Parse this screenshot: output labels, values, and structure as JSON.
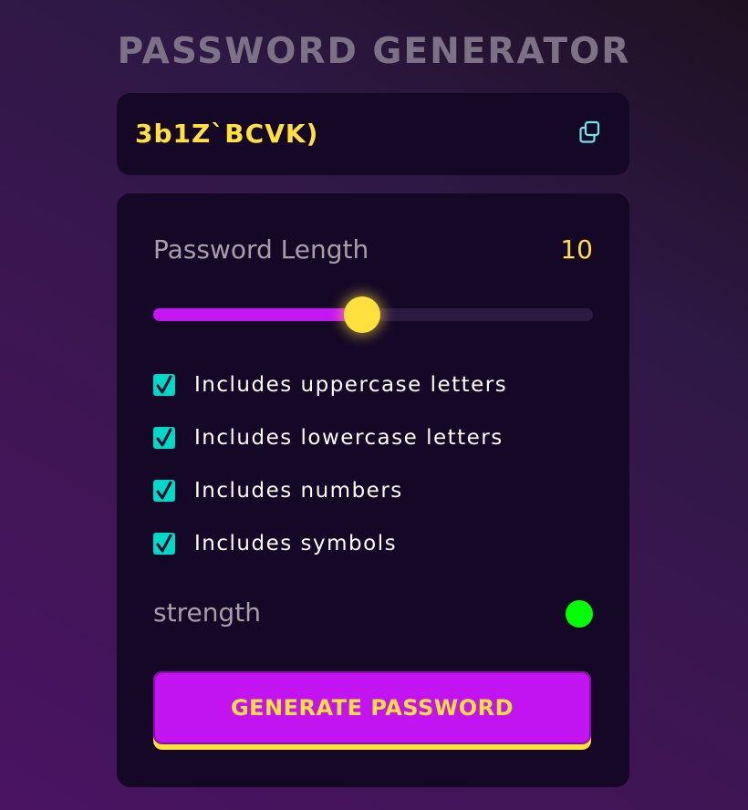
{
  "title": "PASSWORD GENERATOR",
  "password": {
    "value": "3b1Z`BCVK)",
    "copy_icon": "copy-icon"
  },
  "length": {
    "label": "Password Length",
    "value": "10",
    "slider_fraction": 0.475
  },
  "options": [
    {
      "label": "Includes uppercase letters",
      "checked": true
    },
    {
      "label": "Includes lowercase letters",
      "checked": true
    },
    {
      "label": "Includes numbers",
      "checked": true
    },
    {
      "label": "Includes symbols",
      "checked": true
    }
  ],
  "strength": {
    "label": "strength",
    "indicator_color": "#00ff00"
  },
  "generate_button": {
    "label": "GENERATE PASSWORD"
  },
  "colors": {
    "accent": "#ffe03d",
    "primary": "#c214f0",
    "checkbox": "#00d8c8",
    "panel": "#150826"
  }
}
